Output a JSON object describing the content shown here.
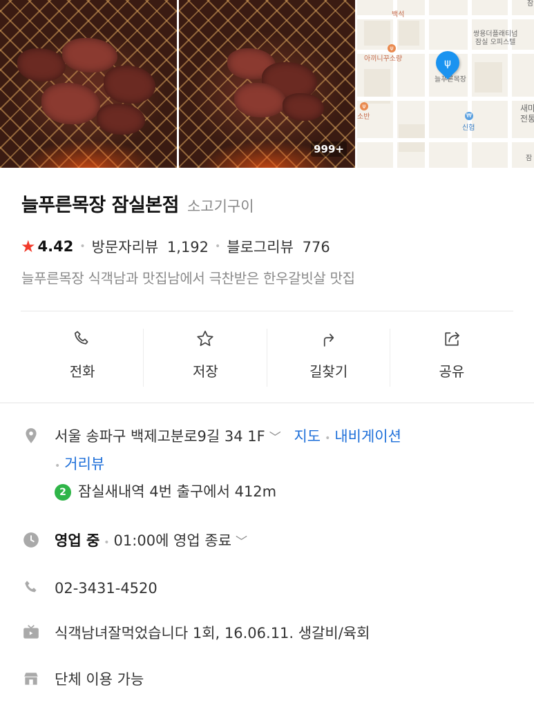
{
  "gallery": {
    "photo_count": "999+",
    "map_labels": {
      "top": "백석",
      "building": "쌍용더플래티넘\n잠실 오피스텔",
      "restaurant_a": "아끼니꾸소량",
      "restaurant_b": "소반",
      "pin_label": "늘푸른목장",
      "bank": "신협",
      "edge_top": "잠",
      "edge_mid": "새마\n전통",
      "edge_bottom": "잠"
    }
  },
  "place": {
    "name": "늘푸른목장 잠실본점",
    "category": "소고기구이",
    "rating": "4.42",
    "visitor_reviews_label": "방문자리뷰",
    "visitor_reviews_count": "1,192",
    "blog_reviews_label": "블로그리뷰",
    "blog_reviews_count": "776",
    "description": "늘푸른목장 식객남과 맛집남에서 극찬받은 한우갈빗살 맛집"
  },
  "actions": [
    {
      "label": "전화",
      "icon": "phone-icon"
    },
    {
      "label": "저장",
      "icon": "star-icon"
    },
    {
      "label": "길찾기",
      "icon": "directions-icon"
    },
    {
      "label": "공유",
      "icon": "share-icon"
    }
  ],
  "info": {
    "address": "서울 송파구 백제고분로9길 34 1F",
    "map_link": "지도",
    "navigation_link": "내비게이션",
    "street_view_link": "거리뷰",
    "subway_line": "2",
    "subway_text": "잠실새내역 4번 출구에서 412m",
    "open_status": "영업 중",
    "hours_text": "01:00에 영업 종료",
    "phone": "02-3431-4520",
    "tv": "식객남녀잘먹었습니다 1회, 16.06.11. 생갈비/육회",
    "facility": "단체 이용 가능"
  },
  "colors": {
    "star": "#f23a2a",
    "link": "#1d6fd9",
    "subway_line_2": "#2fb548",
    "map_pin": "#1a93f0"
  }
}
